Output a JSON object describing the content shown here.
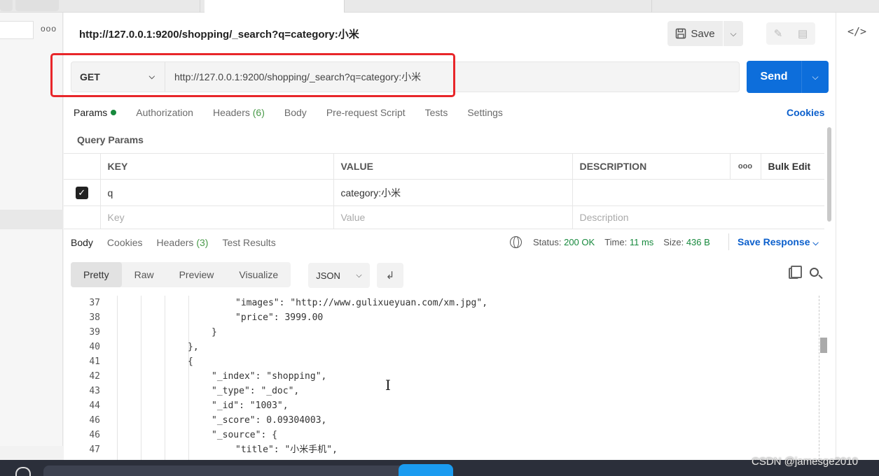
{
  "window": {
    "title": "http://127.0.0.1:9200/shopping/_search?q=category:小米",
    "save_label": "Save"
  },
  "request": {
    "method": "GET",
    "url": "http://127.0.0.1:9200/shopping/_search?q=category:小米",
    "send_label": "Send"
  },
  "request_tabs": [
    {
      "label": "Params"
    },
    {
      "label": "Authorization"
    },
    {
      "label": "Headers",
      "count": "(6)"
    },
    {
      "label": "Body"
    },
    {
      "label": "Pre-request Script"
    },
    {
      "label": "Tests"
    },
    {
      "label": "Settings"
    }
  ],
  "cookies_label": "Cookies",
  "query_params": {
    "title": "Query Params",
    "headers": {
      "key": "KEY",
      "value": "VALUE",
      "description": "DESCRIPTION",
      "bulk": "Bulk Edit",
      "more": "ooo"
    },
    "rows": [
      {
        "key": "q",
        "value": "category:小米",
        "description": ""
      }
    ],
    "placeholder": {
      "key": "Key",
      "value": "Value",
      "description": "Description"
    }
  },
  "response_tabs": [
    {
      "label": "Body"
    },
    {
      "label": "Cookies"
    },
    {
      "label": "Headers",
      "count": "(3)"
    },
    {
      "label": "Test Results"
    }
  ],
  "response_meta": {
    "status_label": "Status:",
    "status_value": "200 OK",
    "time_label": "Time:",
    "time_value": "11 ms",
    "size_label": "Size:",
    "size_value": "436 B",
    "save_response": "Save Response"
  },
  "view_modes": [
    "Pretty",
    "Raw",
    "Preview",
    "Visualize"
  ],
  "format": "JSON",
  "code_lines": [
    {
      "n": "37",
      "text": "\"images\": \"http://www.gulixueyuan.com/xm.jpg\","
    },
    {
      "n": "38",
      "text": "\"price\": 3999.00"
    },
    {
      "n": "39",
      "text": "}"
    },
    {
      "n": "40",
      "text": "},"
    },
    {
      "n": "41",
      "text": "{"
    },
    {
      "n": "42",
      "text": "\"_index\": \"shopping\","
    },
    {
      "n": "43",
      "text": "\"_type\": \"_doc\","
    },
    {
      "n": "44",
      "text": "\"_id\": \"1003\","
    },
    {
      "n": "46",
      "text": "\"_score\": 0.09304003,"
    },
    {
      "n": "46",
      "text": "\"_source\": {"
    },
    {
      "n": "47",
      "text": "\"title\": \"小米手机\","
    }
  ],
  "watermark": "CSDN @jamesge2010",
  "sidebar_dots": "ooo"
}
